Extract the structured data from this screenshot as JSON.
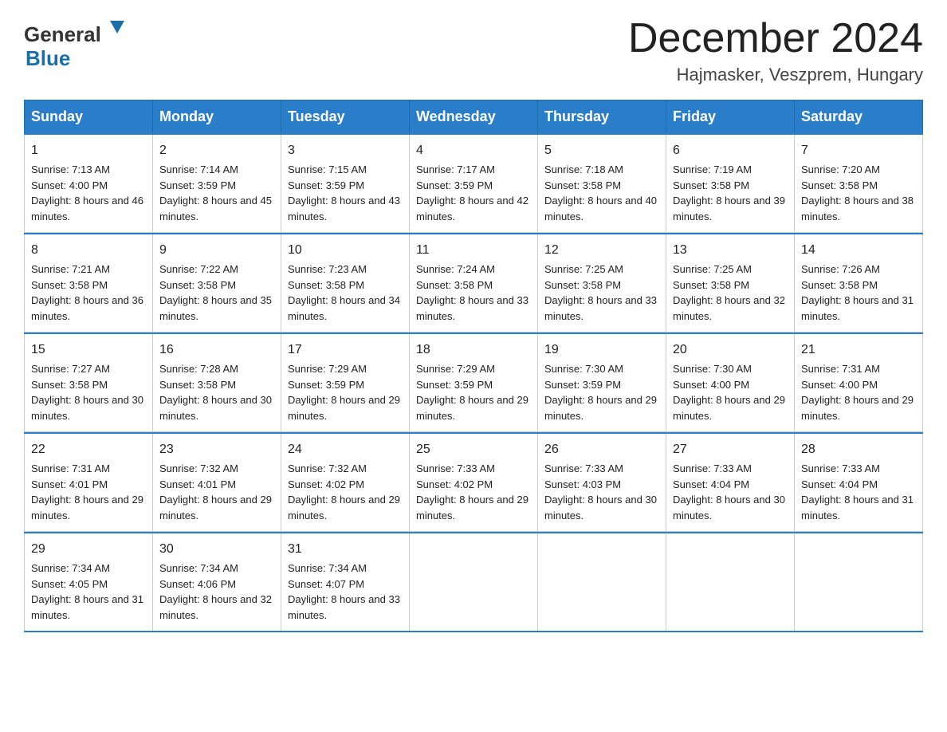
{
  "header": {
    "logo_general": "General",
    "logo_blue": "Blue",
    "month_title": "December 2024",
    "location": "Hajmasker, Veszprem, Hungary"
  },
  "days_of_week": [
    "Sunday",
    "Monday",
    "Tuesday",
    "Wednesday",
    "Thursday",
    "Friday",
    "Saturday"
  ],
  "weeks": [
    [
      {
        "day": "1",
        "sunrise": "7:13 AM",
        "sunset": "4:00 PM",
        "daylight": "8 hours and 46 minutes."
      },
      {
        "day": "2",
        "sunrise": "7:14 AM",
        "sunset": "3:59 PM",
        "daylight": "8 hours and 45 minutes."
      },
      {
        "day": "3",
        "sunrise": "7:15 AM",
        "sunset": "3:59 PM",
        "daylight": "8 hours and 43 minutes."
      },
      {
        "day": "4",
        "sunrise": "7:17 AM",
        "sunset": "3:59 PM",
        "daylight": "8 hours and 42 minutes."
      },
      {
        "day": "5",
        "sunrise": "7:18 AM",
        "sunset": "3:58 PM",
        "daylight": "8 hours and 40 minutes."
      },
      {
        "day": "6",
        "sunrise": "7:19 AM",
        "sunset": "3:58 PM",
        "daylight": "8 hours and 39 minutes."
      },
      {
        "day": "7",
        "sunrise": "7:20 AM",
        "sunset": "3:58 PM",
        "daylight": "8 hours and 38 minutes."
      }
    ],
    [
      {
        "day": "8",
        "sunrise": "7:21 AM",
        "sunset": "3:58 PM",
        "daylight": "8 hours and 36 minutes."
      },
      {
        "day": "9",
        "sunrise": "7:22 AM",
        "sunset": "3:58 PM",
        "daylight": "8 hours and 35 minutes."
      },
      {
        "day": "10",
        "sunrise": "7:23 AM",
        "sunset": "3:58 PM",
        "daylight": "8 hours and 34 minutes."
      },
      {
        "day": "11",
        "sunrise": "7:24 AM",
        "sunset": "3:58 PM",
        "daylight": "8 hours and 33 minutes."
      },
      {
        "day": "12",
        "sunrise": "7:25 AM",
        "sunset": "3:58 PM",
        "daylight": "8 hours and 33 minutes."
      },
      {
        "day": "13",
        "sunrise": "7:25 AM",
        "sunset": "3:58 PM",
        "daylight": "8 hours and 32 minutes."
      },
      {
        "day": "14",
        "sunrise": "7:26 AM",
        "sunset": "3:58 PM",
        "daylight": "8 hours and 31 minutes."
      }
    ],
    [
      {
        "day": "15",
        "sunrise": "7:27 AM",
        "sunset": "3:58 PM",
        "daylight": "8 hours and 30 minutes."
      },
      {
        "day": "16",
        "sunrise": "7:28 AM",
        "sunset": "3:58 PM",
        "daylight": "8 hours and 30 minutes."
      },
      {
        "day": "17",
        "sunrise": "7:29 AM",
        "sunset": "3:59 PM",
        "daylight": "8 hours and 29 minutes."
      },
      {
        "day": "18",
        "sunrise": "7:29 AM",
        "sunset": "3:59 PM",
        "daylight": "8 hours and 29 minutes."
      },
      {
        "day": "19",
        "sunrise": "7:30 AM",
        "sunset": "3:59 PM",
        "daylight": "8 hours and 29 minutes."
      },
      {
        "day": "20",
        "sunrise": "7:30 AM",
        "sunset": "4:00 PM",
        "daylight": "8 hours and 29 minutes."
      },
      {
        "day": "21",
        "sunrise": "7:31 AM",
        "sunset": "4:00 PM",
        "daylight": "8 hours and 29 minutes."
      }
    ],
    [
      {
        "day": "22",
        "sunrise": "7:31 AM",
        "sunset": "4:01 PM",
        "daylight": "8 hours and 29 minutes."
      },
      {
        "day": "23",
        "sunrise": "7:32 AM",
        "sunset": "4:01 PM",
        "daylight": "8 hours and 29 minutes."
      },
      {
        "day": "24",
        "sunrise": "7:32 AM",
        "sunset": "4:02 PM",
        "daylight": "8 hours and 29 minutes."
      },
      {
        "day": "25",
        "sunrise": "7:33 AM",
        "sunset": "4:02 PM",
        "daylight": "8 hours and 29 minutes."
      },
      {
        "day": "26",
        "sunrise": "7:33 AM",
        "sunset": "4:03 PM",
        "daylight": "8 hours and 30 minutes."
      },
      {
        "day": "27",
        "sunrise": "7:33 AM",
        "sunset": "4:04 PM",
        "daylight": "8 hours and 30 minutes."
      },
      {
        "day": "28",
        "sunrise": "7:33 AM",
        "sunset": "4:04 PM",
        "daylight": "8 hours and 31 minutes."
      }
    ],
    [
      {
        "day": "29",
        "sunrise": "7:34 AM",
        "sunset": "4:05 PM",
        "daylight": "8 hours and 31 minutes."
      },
      {
        "day": "30",
        "sunrise": "7:34 AM",
        "sunset": "4:06 PM",
        "daylight": "8 hours and 32 minutes."
      },
      {
        "day": "31",
        "sunrise": "7:34 AM",
        "sunset": "4:07 PM",
        "daylight": "8 hours and 33 minutes."
      },
      null,
      null,
      null,
      null
    ]
  ]
}
